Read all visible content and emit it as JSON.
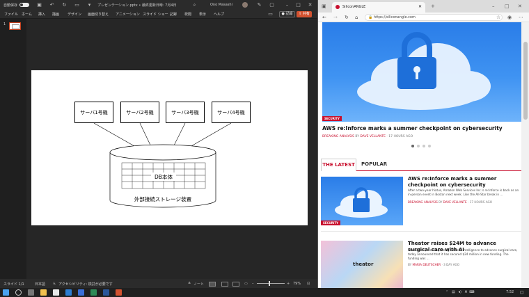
{
  "ppt": {
    "autosave_label": "自動保存",
    "autosave_state": "オン",
    "file_title": "プレゼンテーション.pptx • 最終更新日時: 7月4日",
    "user_name": "Ono Masashi",
    "record_label": "記録",
    "share_label": "共有",
    "menu": [
      "ファイル",
      "ホーム",
      "挿入",
      "描画",
      "デザイン",
      "画面切り替え",
      "アニメーション",
      "スライド ショー",
      "記録",
      "校閲",
      "表示",
      "ヘルプ"
    ],
    "thumb_number": "1",
    "slide": {
      "servers": [
        "サーバ1号機",
        "サーバ2号機",
        "サーバ3号機",
        "サーバ4号機"
      ],
      "db_label": "DB本体",
      "storage_label": "外部接続ストレージ装置"
    },
    "status": {
      "slide": "スライド 1/1",
      "lang": "日本語",
      "accessibility": "アクセシビリティ: 検討が必要です",
      "notes": "ノート",
      "zoom": "79%"
    }
  },
  "edge": {
    "tab_title": "SiliconANGLE",
    "url": "https://siliconangle.com",
    "hero": {
      "badge": "SECURITY",
      "title": "AWS re:Inforce marks a summer checkpoint on cybersecurity",
      "category": "BREAKING ANALYSIS",
      "by": "BY",
      "author": "DAVE VELLANTE",
      "time": "17 HOURS AGO"
    },
    "tabs": {
      "latest": "THE LATEST",
      "popular": "POPULAR"
    },
    "articles": [
      {
        "badge": "SECURITY",
        "title": "AWS re:Inforce marks a summer checkpoint on cybersecurity",
        "body": "After a two-year hiatus, Amazon Web Services Inc.'s re:Inforce is back as an in-person event in Boston next week. Like the All-Star break in ...",
        "category": "BREAKING ANALYSIS",
        "by": "BY",
        "author": "DAVE VELLANTE",
        "time": "17 HOURS AGO"
      },
      {
        "title": "Theator raises $24M to advance surgical care with AI",
        "body": "Theator Inc., a startup using artificial intelligence to advance surgical care, today announced that it has secured $24 million in new funding. The funding was ...",
        "by": "BY",
        "author": "MARIA DEUTSCHER",
        "time": "3 DAY AGO",
        "logo": "theator"
      }
    ]
  },
  "taskbar": {
    "lang": "A",
    "time": "7:52"
  },
  "colors": {
    "ppt_accent": "#d35230",
    "sa_red": "#c8102e"
  }
}
